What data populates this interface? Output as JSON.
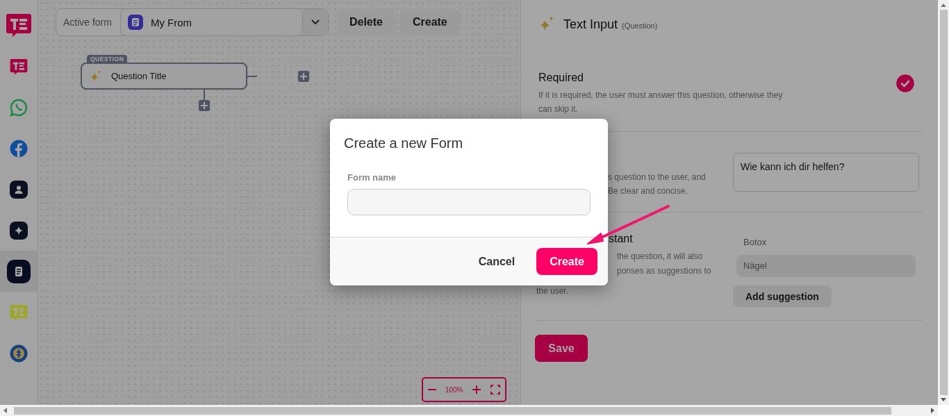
{
  "sidebar": {
    "items": [
      {
        "kind": "brand",
        "selected": false
      },
      {
        "kind": "whatsapp",
        "selected": false
      },
      {
        "kind": "facebook",
        "selected": false
      },
      {
        "kind": "contacts",
        "selected": false
      },
      {
        "kind": "ai",
        "selected": false
      },
      {
        "kind": "forms",
        "selected": true
      },
      {
        "kind": "brand_alt",
        "selected": false
      },
      {
        "kind": "billing",
        "selected": false
      }
    ]
  },
  "toolbar": {
    "active_form_label": "Active form",
    "active_form": "My From",
    "buttons": [
      "Delete",
      "Create"
    ]
  },
  "canvas": {
    "node": {
      "tag": "QUESTION",
      "title": "Question Title"
    },
    "zoom": "100%"
  },
  "panel": {
    "title": "Text Input",
    "subtitle": "(Question)",
    "sections": [
      {
        "kind": "toggle",
        "title": "Required",
        "description": "If it is required, the user must answer this question, otherwise they can skip it.",
        "checked": true
      },
      {
        "kind": "text",
        "lines": [
          "s question to the user, and",
          "Be clear and concise."
        ],
        "value": "Wie kann ich dir helfen?"
      },
      {
        "kind": "suggestions",
        "title": "stant",
        "lines": [
          "the question, it will also",
          "ponses as suggestions to",
          "the user."
        ],
        "label": "Botox",
        "suggestions": [
          "Nägel"
        ],
        "add_button": "Add suggestion"
      }
    ],
    "save": "Save"
  },
  "modal": {
    "title": "Create a new Form",
    "field_label": "Form name",
    "buttons": [
      {
        "label": "Cancel",
        "kind": "secondary"
      },
      {
        "label": "Create",
        "kind": "primary"
      }
    ]
  }
}
